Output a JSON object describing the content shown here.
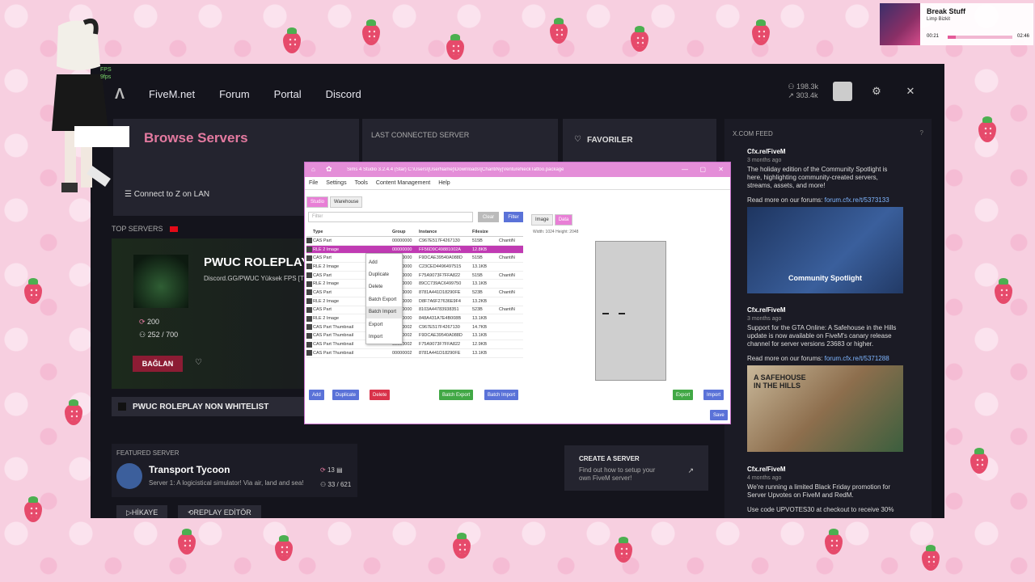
{
  "fivem": {
    "nav": {
      "logo": "Λ",
      "links": [
        "FiveM.net",
        "Forum",
        "Portal",
        "Discord"
      ],
      "stat_players": "198.3k",
      "stat_servers": "303.4k"
    },
    "browse": {
      "title": "Browse Servers",
      "lan_label": "Connect to Z on LAN"
    },
    "last_connected": {
      "title": "LAST CONNECTED SERVER"
    },
    "favorites": {
      "title": "FAVORILER"
    },
    "top_servers": {
      "label": "TOP SERVERS",
      "hero": {
        "name": "PWUC ROLEPLAY",
        "subtitle": "Discord.GG/PWUC Yüksek FPS [TP",
        "players_icon_value": "200",
        "players": "252 / 700",
        "connect_label": "BAĞLAN"
      },
      "bar_name": "PWUC ROLEPLAY NON WHITELIST"
    },
    "featured": {
      "label": "FEATURED SERVER",
      "name": "Transport Tycoon",
      "desc": "Server 1: A logicistical simulator! Via air, land and sea!",
      "boost": "13",
      "players": "33 / 621"
    },
    "create": {
      "title": "CREATE A SERVER",
      "desc": "Find out how to setup your own FiveM server!"
    },
    "footer": {
      "hikaye": "HİKAYE",
      "replay": "REPLAY EDİTÖR"
    },
    "xfeed": {
      "title": "X.COM FEED",
      "posts": [
        {
          "author": "Cfx.re/FiveM",
          "time": "3 months ago",
          "body": "The holiday edition of the Community Spotlight is here, highlighting community-created servers, streams, assets, and more!",
          "link_prefix": "Read more on our forums: ",
          "link": "forum.cfx.re/t/5373133",
          "image_caption": "Community Spotlight"
        },
        {
          "author": "Cfx.re/FiveM",
          "time": "3 months ago",
          "body": "Support for the GTA Online: A Safehouse in the Hills update is now available on FiveM's canary release channel for server versions 23683 or higher.",
          "link_prefix": "Read more on our forums: ",
          "link": "forum.cfx.re/t/5371288",
          "image_caption": "A SAFEHOUSE IN THE HILLS"
        },
        {
          "author": "Cfx.re/FiveM",
          "time": "4 months ago",
          "body": "We're running a limited Black Friday promotion for Server Upvotes on FiveM and RedM.",
          "extra": "Use code UPVOTES30 at checkout to receive 30%"
        }
      ]
    }
  },
  "s4s": {
    "title": "Sims 4 Studio 3.2.4.4 (Star)  C:\\Users\\[UserName]\\Downloads\\[ChantiNy]VentureNeckTattoo.package",
    "menu": [
      "File",
      "Settings",
      "Tools",
      "Content Management",
      "Help"
    ],
    "tabs": [
      "Studio",
      "Warehouse"
    ],
    "filter_placeholder": "Filter",
    "clear_label": "Clear",
    "filter_label": "Filter",
    "columns": [
      "Type",
      "Group",
      "Instance",
      "Filesize",
      ""
    ],
    "rows": [
      {
        "type": "CAS Part",
        "group": "00000000",
        "instance": "C967E517F4267130",
        "size": "515B",
        "extra": "ChantiN"
      },
      {
        "type": "RLE 2 Image",
        "group": "00000000",
        "instance": "FF56D9C49881002A",
        "size": "12.8KB",
        "extra": ""
      },
      {
        "type": "CAS Part",
        "group": "00000000",
        "instance": "F9DCAE39540A088D",
        "size": "515B",
        "extra": "ChantiN"
      },
      {
        "type": "RLE 2 Image",
        "group": "00000000",
        "instance": "C23CED4496497515",
        "size": "13.1KB",
        "extra": ""
      },
      {
        "type": "CAS Part",
        "group": "00000000",
        "instance": "F75A9073F7FFA822",
        "size": "515B",
        "extra": "ChantiN"
      },
      {
        "type": "RLE 2 Image",
        "group": "00000000",
        "instance": "89CC739AC6499750",
        "size": "13.1KB",
        "extra": ""
      },
      {
        "type": "CAS Part",
        "group": "00000000",
        "instance": "8781A441D18290FE",
        "size": "523B",
        "extra": "ChantiN"
      },
      {
        "type": "RLE 2 Image",
        "group": "00000000",
        "instance": "D8F7A6F27636E9F4",
        "size": "13.2KB",
        "extra": ""
      },
      {
        "type": "CAS Part",
        "group": "00000000",
        "instance": "8103A44783938351",
        "size": "523B",
        "extra": "ChantiN"
      },
      {
        "type": "RLE 2 Image",
        "group": "00000000",
        "instance": "848A431A7E4B008B",
        "size": "13.1KB",
        "extra": ""
      },
      {
        "type": "CAS Part Thumbnail",
        "group": "00000002",
        "instance": "C967E517F4267130",
        "size": "14.7KB",
        "extra": ""
      },
      {
        "type": "CAS Part Thumbnail",
        "group": "00000002",
        "instance": "F9DCAE39540A088D",
        "size": "13.1KB",
        "extra": ""
      },
      {
        "type": "CAS Part Thumbnail",
        "group": "00000002",
        "instance": "F75A9073F7FFA822",
        "size": "12.9KB",
        "extra": ""
      },
      {
        "type": "CAS Part Thumbnail",
        "group": "00000002",
        "instance": "8781A441D18290FE",
        "size": "13.1KB",
        "extra": ""
      }
    ],
    "context_menu": [
      "Add",
      "Duplicate",
      "Delete",
      "Batch Export",
      "Batch Import",
      "Export",
      "Import"
    ],
    "right_tabs": [
      "Image",
      "Data"
    ],
    "dimensions": "Width: 1024  Height: 2048",
    "buttons": {
      "add": "Add",
      "duplicate": "Duplicate",
      "delete": "Delete",
      "batch_export": "Batch Export",
      "batch_import": "Batch Import",
      "export": "Export",
      "import": "Import",
      "save": "Save"
    }
  },
  "music": {
    "title": "Break Stuff",
    "artist": "Limp Bizkit",
    "elapsed": "00:21",
    "duration": "02:46",
    "progress": 0.13
  },
  "overlay": {
    "fps": "FPS",
    "fps_value": "9fps"
  },
  "colors": {
    "accent_pink": "#e47aa0",
    "s4s_pink": "#e48ed8",
    "fivem_bg": "#14141c"
  }
}
